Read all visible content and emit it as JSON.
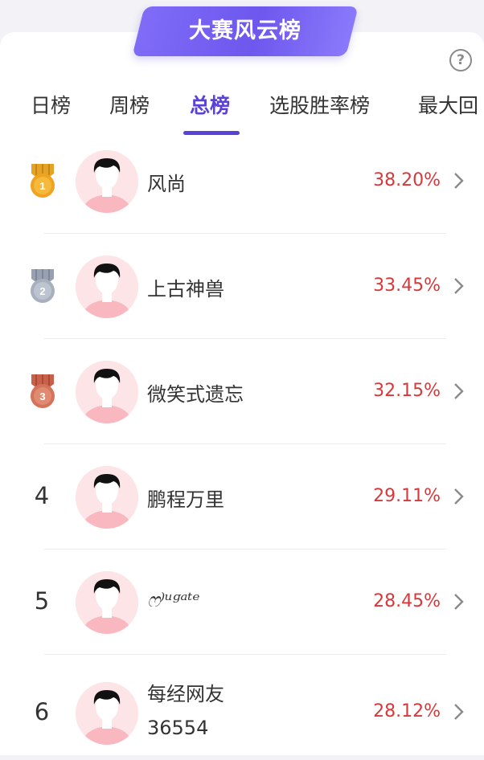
{
  "banner": {
    "title": "大赛风云榜"
  },
  "help": {
    "glyph": "?"
  },
  "tabs": [
    {
      "label": "日榜"
    },
    {
      "label": "周榜"
    },
    {
      "label": "总榜",
      "active": true
    },
    {
      "label": "选股胜率榜"
    },
    {
      "label": "最大回"
    }
  ],
  "colors": {
    "accent": "#5a41d8",
    "positive": "#d6393b",
    "gold": "#f0a321",
    "silver": "#a8b0bd",
    "bronze": "#d4735a"
  },
  "rankings": [
    {
      "rank": "1",
      "medal": "gold",
      "name": "风尚",
      "return": "38.20%"
    },
    {
      "rank": "2",
      "medal": "silver",
      "name": "上古神兽",
      "return": "33.45%"
    },
    {
      "rank": "3",
      "medal": "bronze",
      "name": "微笑式遗忘",
      "return": "32.15%"
    },
    {
      "rank": "4",
      "name": "鹏程万里",
      "return": "29.11%"
    },
    {
      "rank": "5",
      "name": "ෆ⁾ᵘᵍᵃᵗᵉ",
      "return": "28.45%"
    },
    {
      "rank": "6",
      "name_line1": "每经网友",
      "name_line2": "36554",
      "return": "28.12%"
    }
  ]
}
